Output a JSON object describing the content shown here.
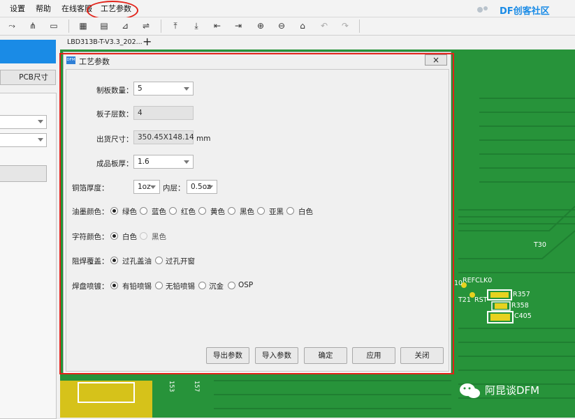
{
  "menu": {
    "items": [
      "设置",
      "帮助",
      "在线客服",
      "工艺参数"
    ]
  },
  "watermark_top": "DF创客社区",
  "watermark_bottom": "阿昆谈DFM",
  "left_panel": {
    "button_label": "PCB尺寸"
  },
  "tabs": {
    "active_tab": "LBD313B-T-V3.3_202...",
    "add_label": "+"
  },
  "dialog": {
    "title": "工艺参数",
    "close_label": "×",
    "panel_count": {
      "label": "制板数量：",
      "value": "5"
    },
    "layer_count": {
      "label": "板子层数：",
      "value": "4"
    },
    "ship_size": {
      "label": "出货尺寸：",
      "value": "350.45X148.14",
      "unit": "mm"
    },
    "thickness": {
      "label": "成品板厚：",
      "value": "1.6"
    },
    "copper": {
      "label": "铜箔厚度：",
      "outer": "1oz",
      "inner_label": "内层：",
      "inner": "0.5oz"
    },
    "solder_mask_color": {
      "label": "油墨颜色：",
      "options": [
        "绿色",
        "蓝色",
        "红色",
        "黄色",
        "黑色",
        "亚黑",
        "白色"
      ],
      "selected": "绿色"
    },
    "silk_color": {
      "label": "字符颜色：",
      "options": [
        "白色",
        "黑色"
      ],
      "selected": "白色"
    },
    "via_cover": {
      "label": "阻焊覆盖：",
      "options": [
        "过孔盖油",
        "过孔开窗"
      ],
      "selected": "过孔盖油"
    },
    "surface_finish": {
      "label": "焊盘喷镀：",
      "options": [
        "有铅喷锡",
        "无铅喷锡",
        "沉金",
        "OSP"
      ],
      "selected": "有铅喷锡"
    },
    "buttons": {
      "export": "导出参数",
      "import": "导入参数",
      "ok": "确定",
      "apply": "应用",
      "close": "关闭"
    }
  },
  "board_labels": {
    "t30": "T30",
    "refclk": "REFCLK0",
    "t21": "T21",
    "rst": "RST",
    "r357": "R357",
    "r358": "R358",
    "c405": "C405",
    "l10": "10",
    "n153": "153",
    "n157": "157"
  },
  "colors": {
    "board_green": "#27933a",
    "highlight_red": "#e2231a",
    "accent_blue": "#1a8be6"
  }
}
